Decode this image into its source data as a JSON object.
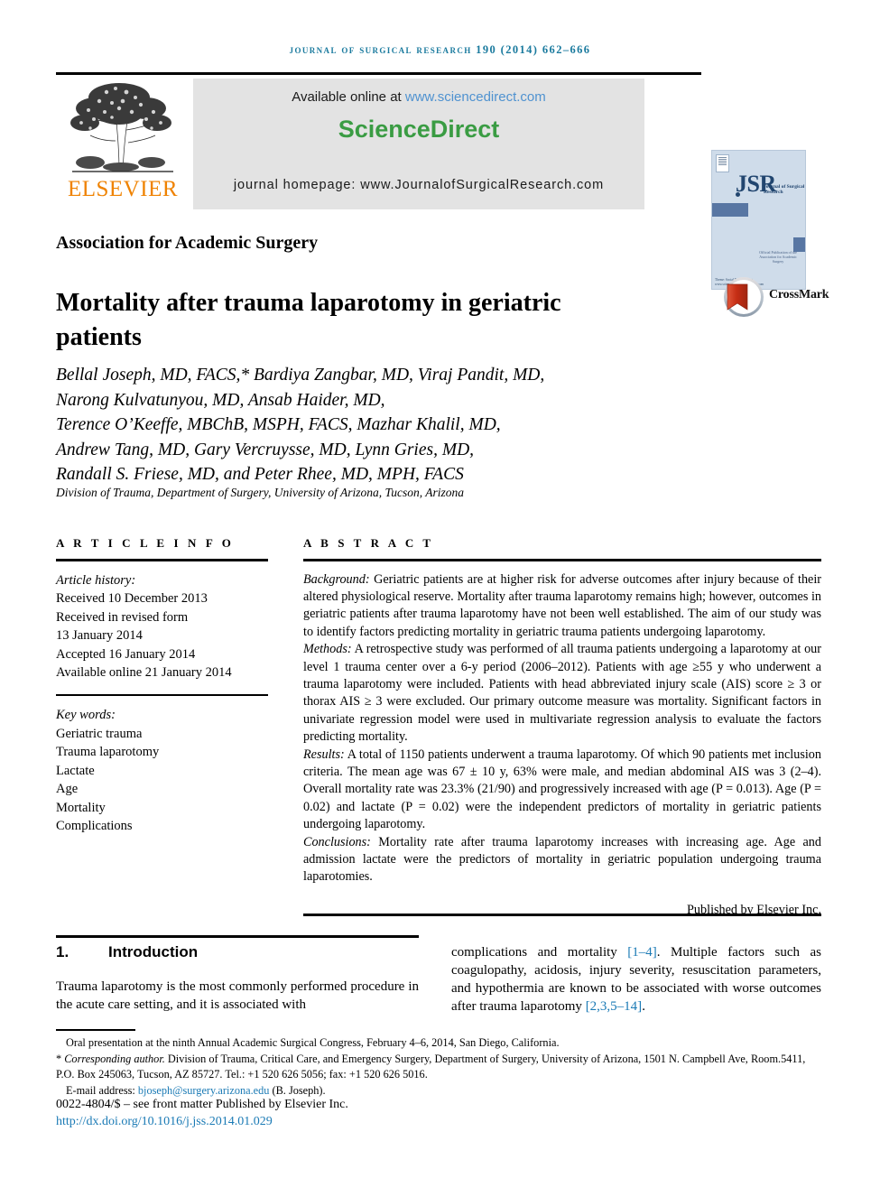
{
  "running_head": "Journal of Surgical Research 190 (2014) 662–666",
  "masthead": {
    "publisher_name": "ELSEVIER",
    "available_prefix": "Available online at ",
    "available_link": "www.sciencedirect.com",
    "sciencedirect_word": "ScienceDirect",
    "journal_homepage": "journal homepage: www.JournalofSurgicalResearch.com",
    "cover": {
      "acronym": "JSR",
      "subtitle": "Journal of Surgical Research",
      "footer_note": "Official Publication of the Association for Academic Surgery",
      "bottom_note": "Theme: Social Resources.org  www.scienceofSurgicalResearch.com"
    }
  },
  "article": {
    "association": "Association for Academic Surgery",
    "title": "Mortality after trauma laparotomy in geriatric patients",
    "crossmark_label": "CrossMark",
    "authors": "Bellal Joseph, MD, FACS,* Bardiya Zangbar, MD, Viraj Pandit, MD, Narong Kulvatunyou, MD, Ansab Haider, MD, Terence O’Keeffe, MBChB, MSPH, FACS, Mazhar Khalil, MD, Andrew Tang, MD, Gary Vercruysse, MD, Lynn Gries, MD, Randall S. Friese, MD, and Peter Rhee, MD, MPH, FACS",
    "author_lines": [
      "Bellal Joseph, MD, FACS,* Bardiya Zangbar, MD, Viraj Pandit, MD,",
      "Narong Kulvatunyou, MD, Ansab Haider, MD,",
      "Terence O’Keeffe, MBChB, MSPH, FACS, Mazhar Khalil, MD,",
      "Andrew Tang, MD, Gary Vercruysse, MD, Lynn Gries, MD,",
      "Randall S. Friese, MD, and Peter Rhee, MD, MPH, FACS"
    ],
    "affiliation": "Division of Trauma, Department of Surgery, University of Arizona, Tucson, Arizona"
  },
  "article_info": {
    "heading": "A R T I C L E  I N F O",
    "history_label": "Article history:",
    "history": [
      "Received 10 December 2013",
      "Received in revised form",
      "13 January 2014",
      "Accepted 16 January 2014",
      "Available online 21 January 2014"
    ],
    "keywords_label": "Key words:",
    "keywords": [
      "Geriatric trauma",
      "Trauma laparotomy",
      "Lactate",
      "Age",
      "Mortality",
      "Complications"
    ]
  },
  "abstract": {
    "heading": "A B S T R A C T",
    "sections": [
      {
        "label": "Background:",
        "text": " Geriatric patients are at higher risk for adverse outcomes after injury because of their altered physiological reserve. Mortality after trauma laparotomy remains high; however, outcomes in geriatric patients after trauma laparotomy have not been well established. The aim of our study was to identify factors predicting mortality in geriatric trauma patients undergoing laparotomy."
      },
      {
        "label": "Methods:",
        "text": " A retrospective study was performed of all trauma patients undergoing a laparotomy at our level 1 trauma center over a 6-y period (2006–2012). Patients with age ≥55 y who underwent a trauma laparotomy were included. Patients with head abbreviated injury scale (AIS) score ≥ 3 or thorax AIS ≥ 3 were excluded. Our primary outcome measure was mortality. Significant factors in univariate regression model were used in multivariate regression analysis to evaluate the factors predicting mortality."
      },
      {
        "label": "Results:",
        "text": " A total of 1150 patients underwent a trauma laparotomy. Of which 90 patients met inclusion criteria. The mean age was 67 ± 10 y, 63% were male, and median abdominal AIS was 3 (2–4). Overall mortality rate was 23.3% (21/90) and progressively increased with age (P = 0.013). Age (P = 0.02) and lactate (P = 0.02) were the independent predictors of mortality in geriatric patients undergoing laparotomy."
      },
      {
        "label": "Conclusions:",
        "text": " Mortality rate after trauma laparotomy increases with increasing age. Age and admission lactate were the predictors of mortality in geriatric population undergoing trauma laparotomies."
      }
    ],
    "published_by": "Published by Elsevier Inc."
  },
  "introduction": {
    "number": "1.",
    "heading": "Introduction",
    "left_text": "Trauma laparotomy is the most commonly performed procedure in the acute care setting, and it is associated with",
    "right_prefix": "complications and mortality ",
    "right_ref1": "[1–4]",
    "right_middle": ". Multiple factors such as coagulopathy, acidosis, injury severity, resuscitation parameters, and hypothermia are known to be associated with worse outcomes after trauma laparotomy ",
    "right_ref2": "[2,3,5–14]",
    "right_suffix": "."
  },
  "footnotes": {
    "oral_presentation": "Oral presentation at the ninth Annual Academic Surgical Congress, February 4–6, 2014, San Diego, California.",
    "corresponding_marker": "*",
    "corresponding_label": "Corresponding author.",
    "corresponding_text": " Division of Trauma, Critical Care, and Emergency Surgery, Department of Surgery, University of Arizona, 1501 N. Campbell Ave, Room.5411, P.O. Box 245063, Tucson, AZ 85727. Tel.: +1 520 626 5056; fax: +1 520 626 5016.",
    "email_label": "E-mail address: ",
    "email": "bjoseph@surgery.arizona.edu",
    "email_suffix": " (B. Joseph).",
    "issn_line": "0022-4804/$ – see front matter Published by Elsevier Inc.",
    "doi": "http://dx.doi.org/10.1016/j.jss.2014.01.029"
  },
  "colors": {
    "running_head": "#1a7a9e",
    "sciencedirect_green": "#3a9c43",
    "link_blue": "#4f92d0",
    "reference_blue": "#1a7ab5",
    "elsevier_orange": "#ef8200",
    "banner_grey": "#e3e3e3",
    "crossmark_red": "#c9341d",
    "cover_blue": "#cfdcea"
  }
}
